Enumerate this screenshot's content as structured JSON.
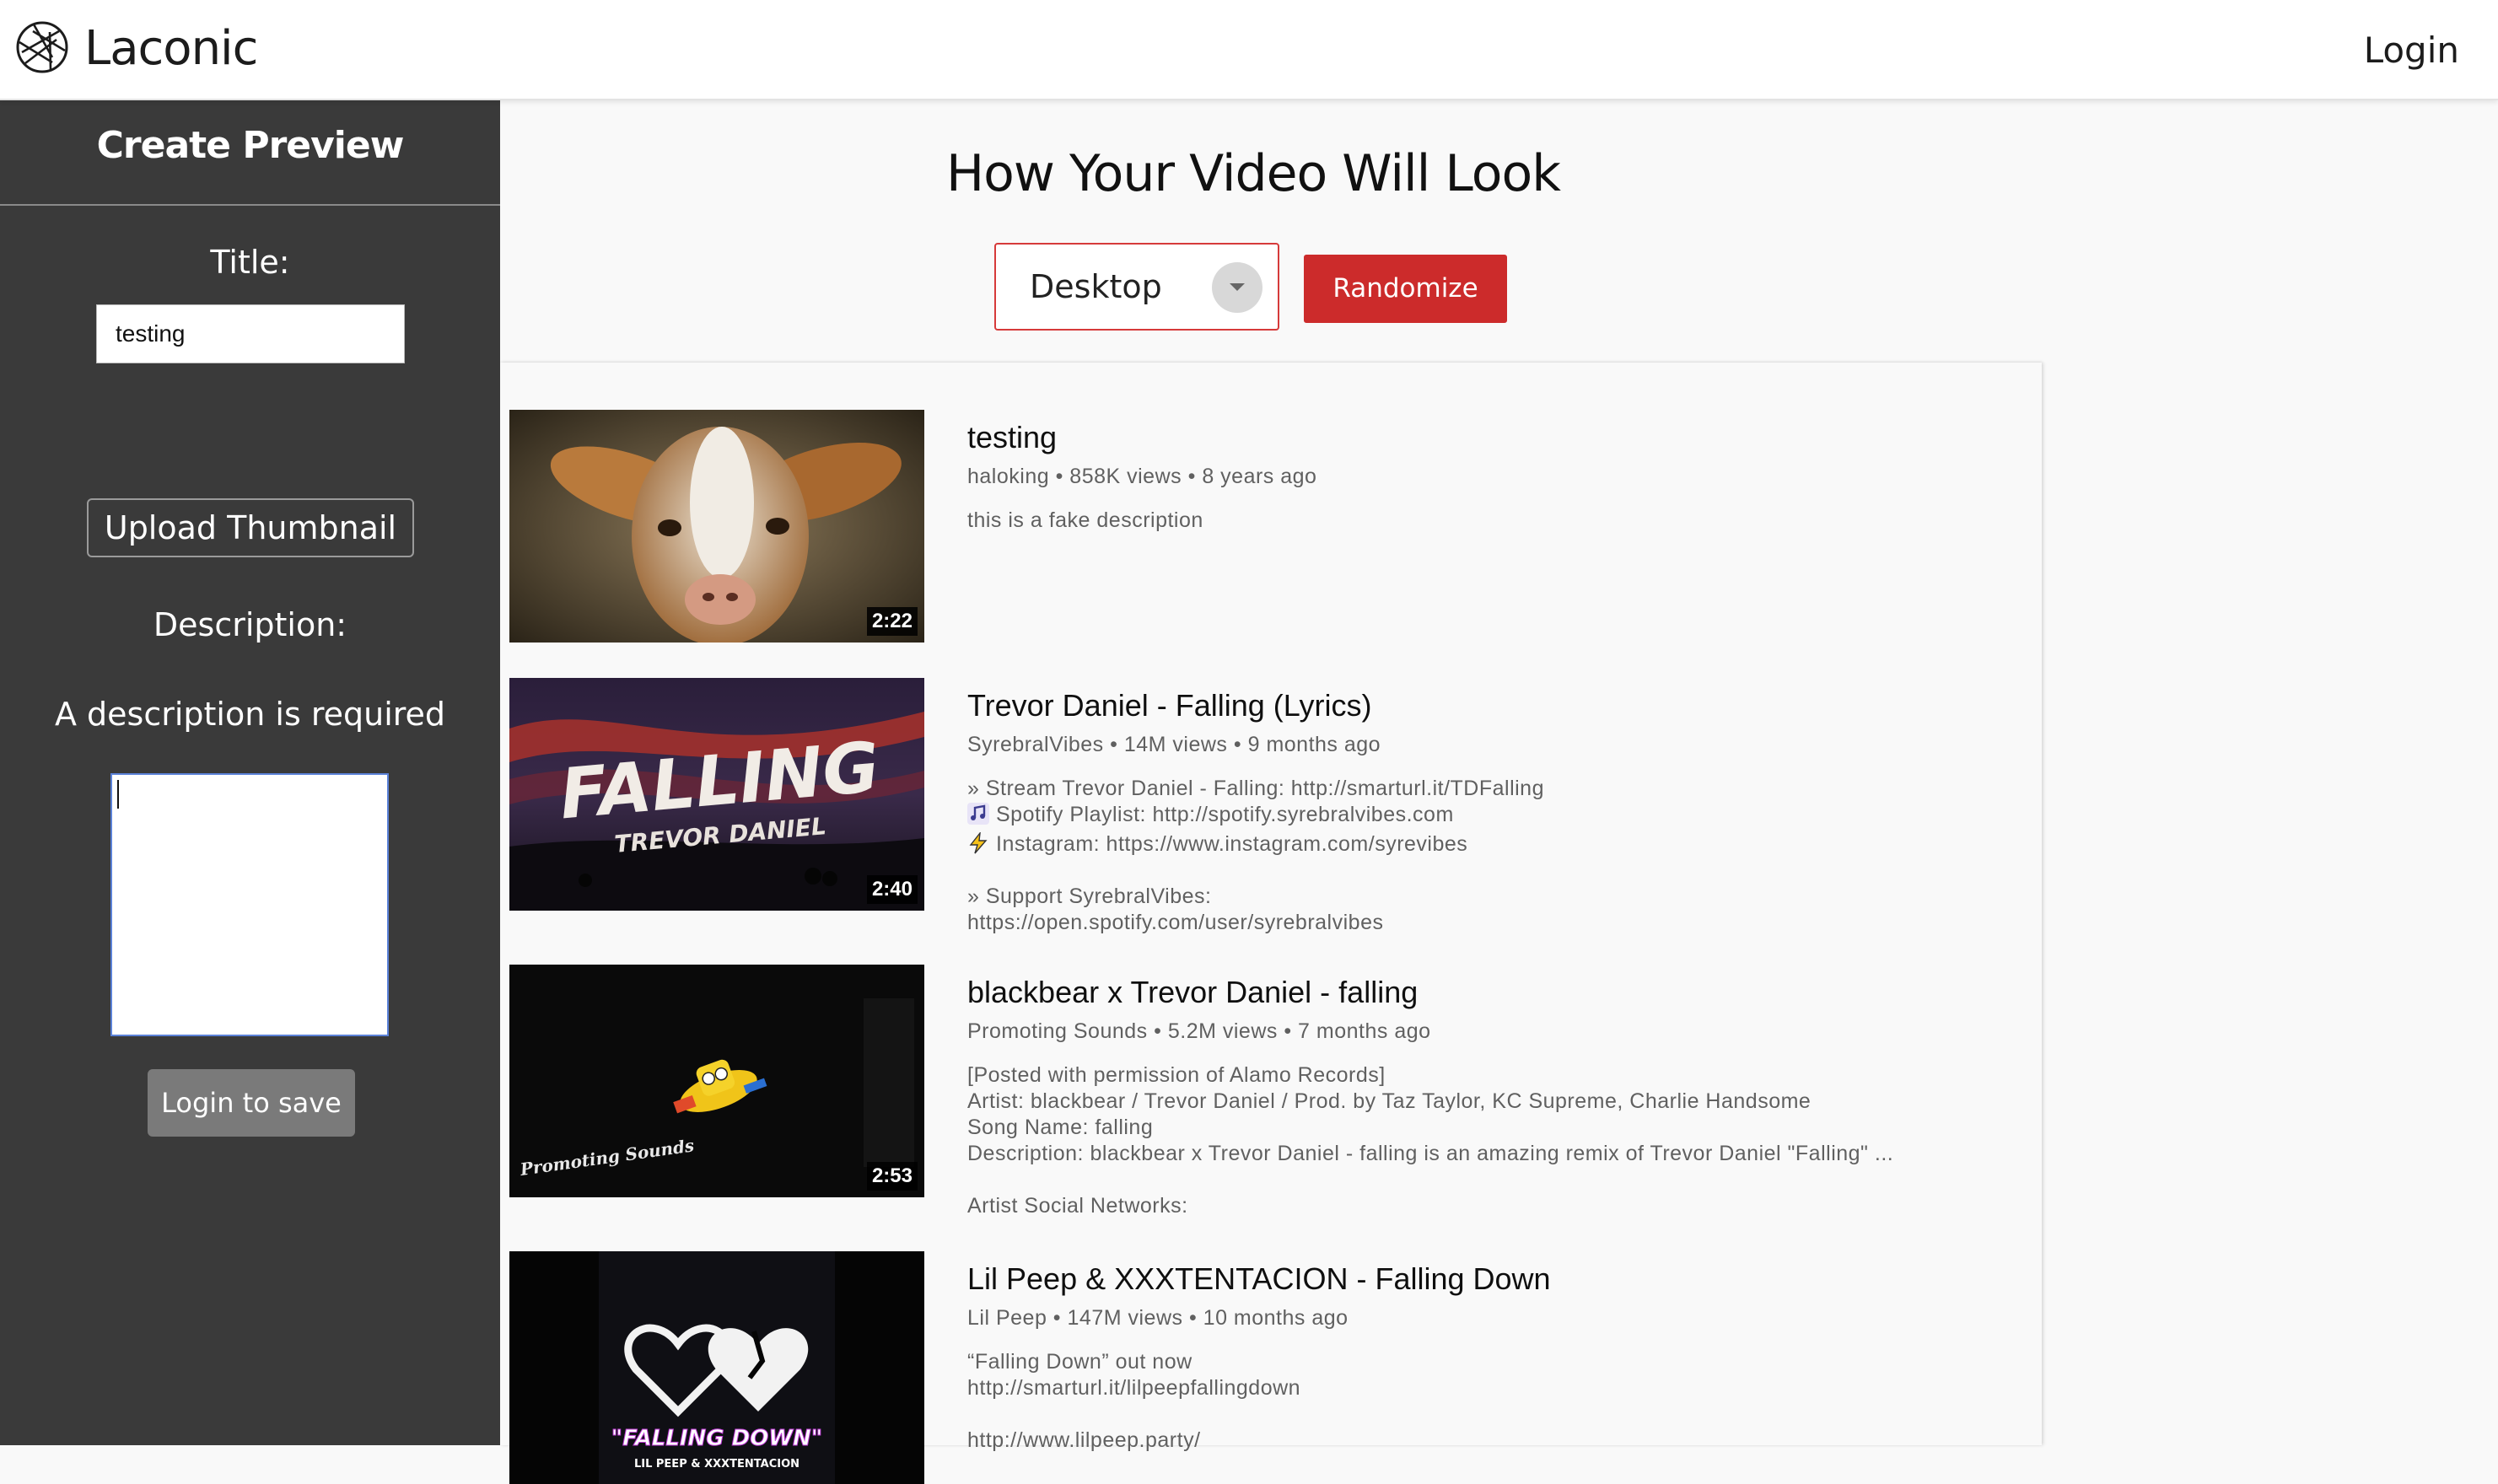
{
  "header": {
    "brand": "Laconic",
    "login_label": "Login"
  },
  "sidebar": {
    "title": "Create Preview",
    "title_label": "Title:",
    "title_value": "testing",
    "upload_label": "Upload Thumbnail",
    "description_label": "Description:",
    "description_error": "A description is required",
    "description_value": "",
    "save_label": "Login to save"
  },
  "main": {
    "heading": "How Your Video Will Look",
    "device_selected": "Desktop",
    "randomize_label": "Randomize"
  },
  "videos": [
    {
      "title": "testing",
      "channel": "haloking",
      "views": "858K views",
      "age": "8 years ago",
      "duration": "2:22",
      "description": [
        "this is a fake description"
      ]
    },
    {
      "title": "Trevor Daniel - Falling (Lyrics)",
      "channel": "SyrebralVibes",
      "views": "14M views",
      "age": "9 months ago",
      "duration": "2:40",
      "thumb_text": {
        "main": "FALLING",
        "sub": "TREVOR DANIEL"
      },
      "description": [
        "» Stream Trevor Daniel - Falling: http://smarturl.it/TDFalling",
        "Spotify Playlist: http://spotify.syrebralvibes.com",
        "Instagram: https://www.instagram.com/syrevibes",
        "",
        "» Support SyrebralVibes:",
        "https://open.spotify.com/user/syrebralvibes"
      ]
    },
    {
      "title": "blackbear x Trevor Daniel - falling",
      "channel": "Promoting Sounds",
      "views": "5.2M views",
      "age": "7 months ago",
      "duration": "2:53",
      "thumb_text": {
        "logo": "Promoting Sounds"
      },
      "description": [
        "[Posted with permission of Alamo Records]",
        "Artist: blackbear / Trevor Daniel / Prod. by Taz Taylor, KC Supreme, Charlie Handsome",
        "Song Name: falling",
        "Description: blackbear x Trevor Daniel - falling is an amazing remix of Trevor Daniel \"Falling\" ...",
        "",
        "Artist Social Networks:"
      ]
    },
    {
      "title": "Lil Peep & XXXTENTACION - Falling Down",
      "channel": "Lil Peep",
      "views": "147M views",
      "age": "10 months ago",
      "thumb_text": {
        "main": "\"FALLING DOWN\"",
        "sub": "LIL PEEP & XXXTENTACION"
      },
      "description": [
        "“Falling Down” out now",
        "http://smarturl.it/lilpeepfallingdown",
        "",
        "http://www.lilpeep.party/"
      ]
    }
  ],
  "colors": {
    "accent": "#cc2b2b",
    "sidebar_bg": "#3a3a3a",
    "save_button": "#7a7a7a",
    "meta_text": "#606060"
  },
  "icons": {
    "logo": "aperture-icon",
    "spotify_line": "musical-note-icon",
    "instagram_line": "lightning-icon",
    "select": "chevron-down-icon"
  }
}
